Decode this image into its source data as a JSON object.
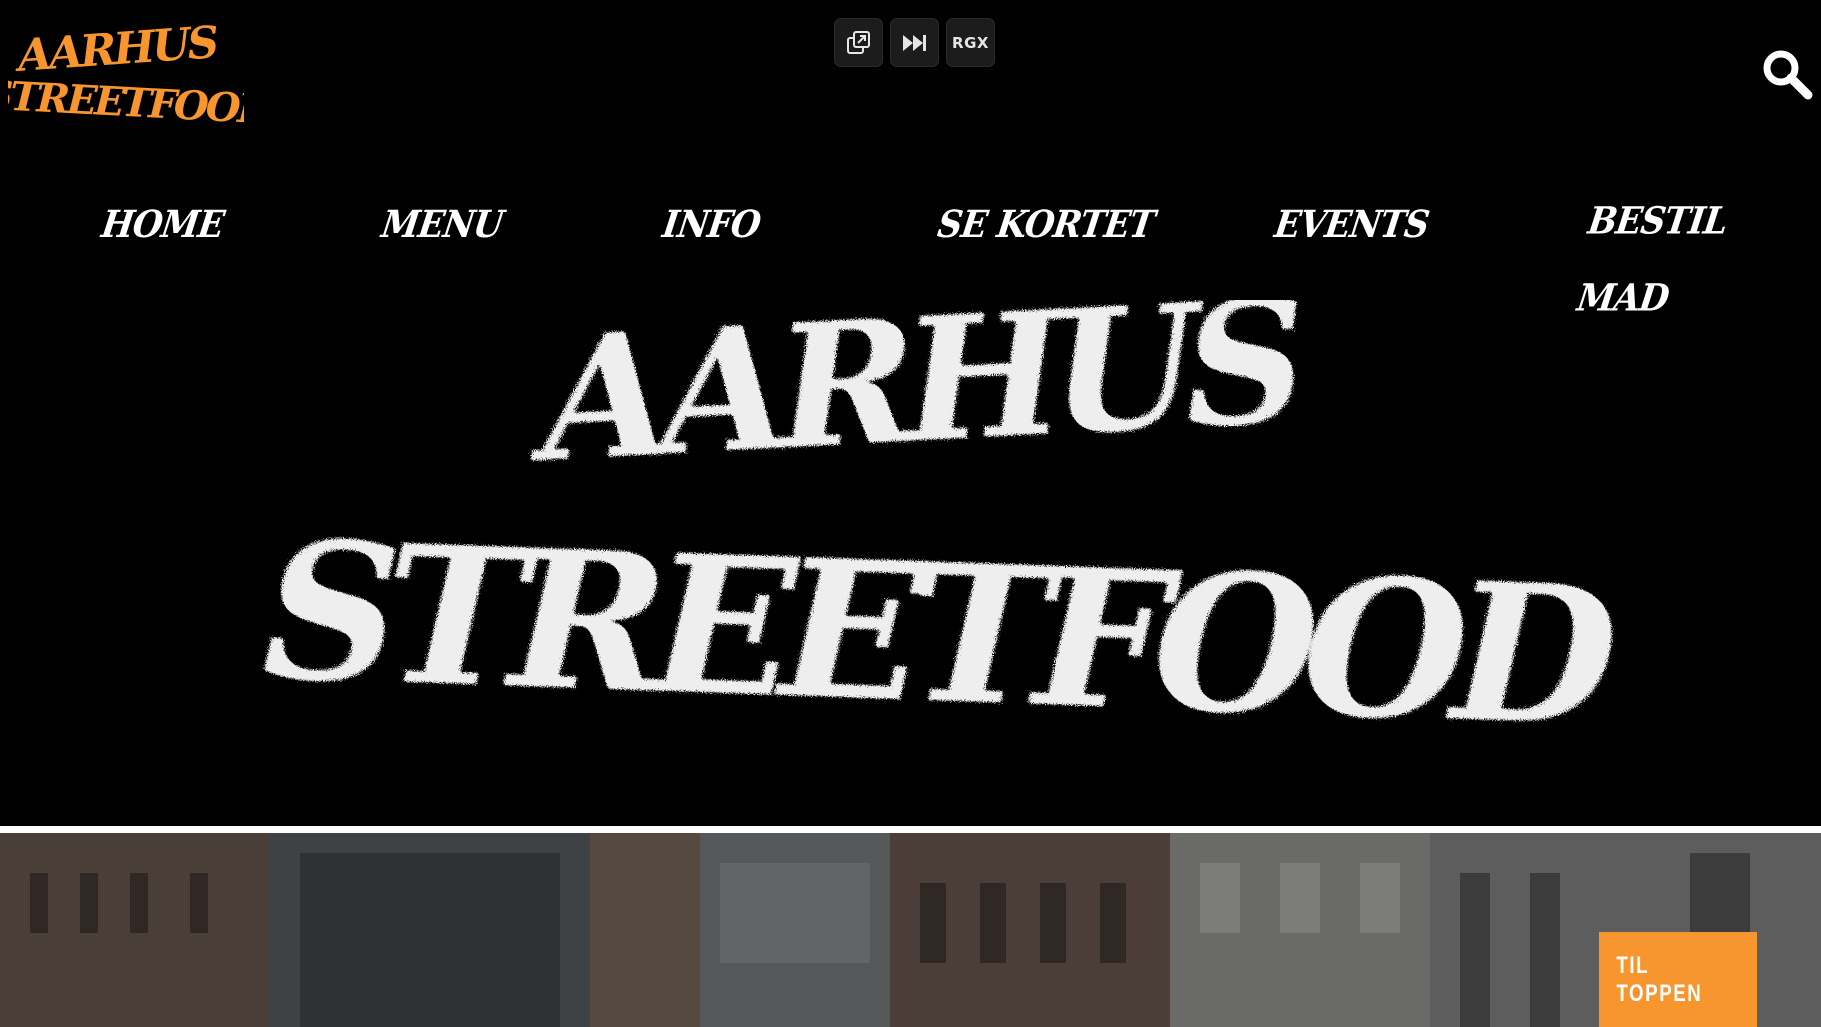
{
  "brand": {
    "logo_text_line1": "AARHUS",
    "logo_text_line2": "STREETFOOD",
    "logo_color": "#f7962e",
    "hero_color": "#eeeeee"
  },
  "toolbar": {
    "popout_icon": "popout-icon",
    "skip_icon": "skip-forward-icon",
    "rgx_label": "RGX"
  },
  "header": {
    "search_icon": "search-icon"
  },
  "nav": {
    "items": [
      {
        "label": "HOME"
      },
      {
        "label": "MENU"
      },
      {
        "label": "INFO"
      },
      {
        "label": "SE KORTET"
      },
      {
        "label": "EVENTS"
      },
      {
        "label": "BESTIL MAD"
      }
    ]
  },
  "hero": {
    "line1": "AARHUS",
    "line2": "STREETFOOD"
  },
  "back_to_top": {
    "label": "TIL TOPPEN",
    "color": "#f7962e"
  }
}
